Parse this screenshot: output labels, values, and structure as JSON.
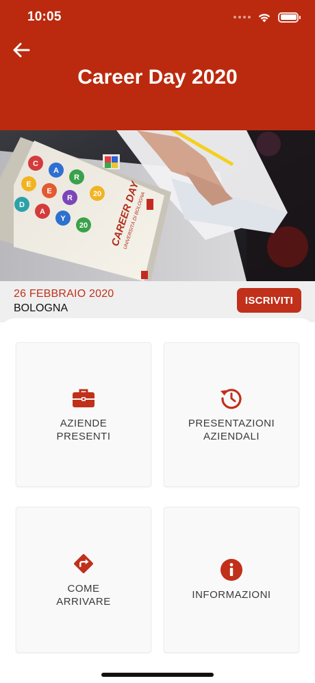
{
  "status_bar": {
    "time": "10:05"
  },
  "header": {
    "title": "Career Day 2020",
    "back_icon": "arrow-left-icon"
  },
  "event": {
    "date": "26 FEBBRAIO 2020",
    "city": "BOLOGNA",
    "subscribe_label": "ISCRIVITI",
    "photo": {
      "booklet_title": "CAREER DAY",
      "booklet_subtitle": "UNIVERSITÀ DI BOLOGNA",
      "booklet_letters": [
        "C",
        "A",
        "R",
        "E",
        "E",
        "R",
        "D",
        "A",
        "Y",
        "20",
        "20"
      ]
    }
  },
  "tiles": [
    {
      "label": "AZIENDE\nPRESENTI",
      "icon": "briefcase-icon"
    },
    {
      "label": "PRESENTAZIONI\nAZIENDALI",
      "icon": "history-clock-icon"
    },
    {
      "label": "COME\nARRIVARE",
      "icon": "directions-icon"
    },
    {
      "label": "INFORMAZIONI",
      "icon": "info-icon"
    }
  ],
  "colors": {
    "brand_red": "#bb2a0e",
    "accent_red": "#c0301a"
  }
}
